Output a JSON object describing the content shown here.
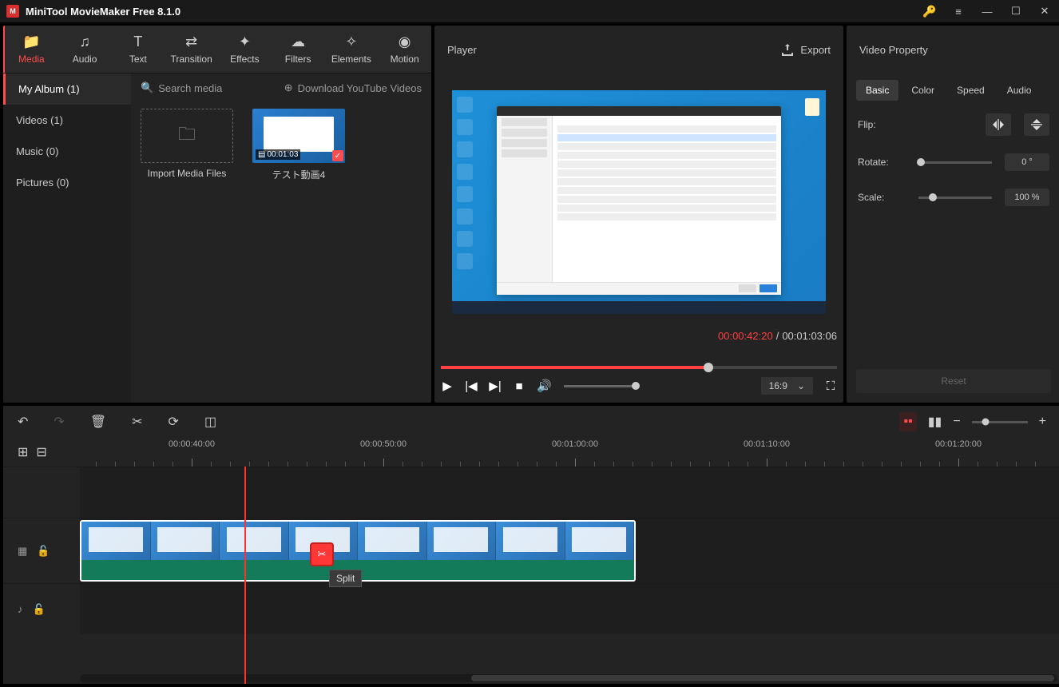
{
  "titlebar": {
    "title": "MiniTool MovieMaker Free 8.1.0"
  },
  "topTabs": [
    {
      "label": "Media",
      "icon": "folder"
    },
    {
      "label": "Audio",
      "icon": "music"
    },
    {
      "label": "Text",
      "icon": "text"
    },
    {
      "label": "Transition",
      "icon": "transition"
    },
    {
      "label": "Effects",
      "icon": "fx"
    },
    {
      "label": "Filters",
      "icon": "filter"
    },
    {
      "label": "Elements",
      "icon": "sparkle"
    },
    {
      "label": "Motion",
      "icon": "motion"
    }
  ],
  "mediaSidebar": [
    {
      "label": "My Album (1)",
      "active": true
    },
    {
      "label": "Videos (1)"
    },
    {
      "label": "Music (0)"
    },
    {
      "label": "Pictures (0)"
    }
  ],
  "mediaToolbar": {
    "searchPlaceholder": "Search media",
    "download": "Download YouTube Videos"
  },
  "mediaItems": {
    "importLabel": "Import Media Files",
    "clip": {
      "name": "テスト動画4",
      "duration": "00:01:03"
    }
  },
  "player": {
    "title": "Player",
    "export": "Export",
    "currentTime": "00:00:42:20",
    "totalTime": "00:01:03:06",
    "ratio": "16:9"
  },
  "props": {
    "title": "Video Property",
    "tabs": [
      "Basic",
      "Color",
      "Speed",
      "Audio"
    ],
    "flipLabel": "Flip:",
    "rotateLabel": "Rotate:",
    "rotateVal": "0 °",
    "scaleLabel": "Scale:",
    "scaleVal": "100 %",
    "reset": "Reset"
  },
  "timeline": {
    "labels": [
      "00:00:40:00",
      "00:00:50:00",
      "00:01:00:00",
      "00:01:10:00",
      "00:01:20:00"
    ],
    "splitTip": "Split"
  }
}
